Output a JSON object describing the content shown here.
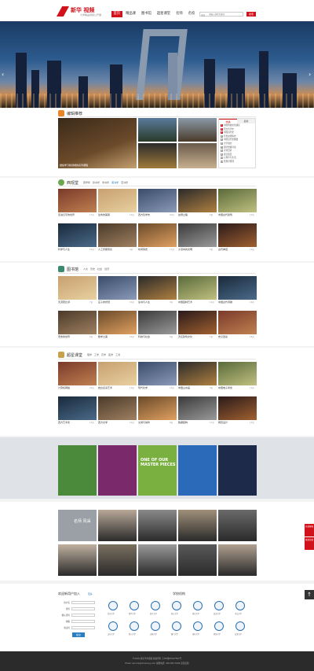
{
  "header": {
    "logo_text": "新华 视频",
    "logo_sub": "大学精品视频公开课",
    "nav": [
      "首页",
      "精品课",
      "图书馆",
      "超星课堂",
      "名师",
      "名校"
    ],
    "search_category": "全站",
    "search_placeholder": "请输入搜索关键词",
    "search_button": "搜索"
  },
  "hero": {
    "prev": "‹",
    "next": "›"
  },
  "recommend": {
    "title": "编辑推荐",
    "featured_caption": "继续学习新领域的系列课程",
    "tabs": [
      "热播",
      "最新"
    ],
    "rank": [
      "中国传统文化通论",
      "西方哲学史",
      "中国古代史",
      "世界文明简史",
      "中国近代史纲要",
      "大学语文",
      "国学经典导读",
      "宋词赏析",
      "唐诗鉴赏",
      "心理学与生活",
      "管理学原理"
    ]
  },
  "sec_culture": {
    "title": "西观堂",
    "tags": [
      "国学新",
      "欧洲史",
      "非洲史",
      "美洲史",
      "亚洲史"
    ],
    "cards": [
      {
        "title": "走进汉字的世界",
        "meta": "17讲"
      },
      {
        "title": "生命的美丽",
        "meta": "12讲"
      },
      {
        "title": "西方哲学史",
        "meta": "20讲"
      },
      {
        "title": "丝绸之路",
        "meta": "8讲"
      },
      {
        "title": "中国古代建筑",
        "meta": "15讲"
      },
      {
        "title": "科学与人生",
        "meta": "10讲"
      },
      {
        "title": "人工智能导论",
        "meta": "9讲"
      },
      {
        "title": "时间简史",
        "meta": "11讲"
      },
      {
        "title": "沙漠中的文明",
        "meta": "6讲"
      },
      {
        "title": "古代神话",
        "meta": "14讲"
      }
    ]
  },
  "sec_library": {
    "title": "图书馆",
    "tags": [
      "人文",
      "历史",
      "社会",
      "经济"
    ],
    "cards": [
      {
        "title": "天涯若比邻",
        "meta": "7讲"
      },
      {
        "title": "庄子的智慧",
        "meta": "13讲"
      },
      {
        "title": "读书与人生",
        "meta": "9讲"
      },
      {
        "title": "中国园林艺术",
        "meta": "12讲"
      },
      {
        "title": "中国古代诗歌",
        "meta": "16讲"
      },
      {
        "title": "老舍的世界",
        "meta": "6讲"
      },
      {
        "title": "数学之美",
        "meta": "10讲"
      },
      {
        "title": "科技与社会",
        "meta": "8讲"
      },
      {
        "title": "天坛建筑文化",
        "meta": "5讲"
      },
      {
        "title": "史记选读",
        "meta": "18讲"
      }
    ]
  },
  "sec_class": {
    "title": "超星课堂",
    "tags": [
      "理学",
      "工学",
      "农学",
      "医学",
      "工商"
    ],
    "cards": [
      {
        "title": "计算机网络",
        "meta": "20讲"
      },
      {
        "title": "舞台表演艺术",
        "meta": "11讲"
      },
      {
        "title": "现代化学",
        "meta": "14讲"
      },
      {
        "title": "中国山水画",
        "meta": "9讲"
      },
      {
        "title": "中国电子商务",
        "meta": "12讲"
      },
      {
        "title": "西方艺术史",
        "meta": "15讲"
      },
      {
        "title": "西方文学",
        "meta": "10讲"
      },
      {
        "title": "交通与城市",
        "meta": "8讲"
      },
      {
        "title": "数据结构",
        "meta": "17讲"
      },
      {
        "title": "网页设计",
        "meta": "13讲"
      }
    ]
  },
  "posters": [
    {
      "text": ""
    },
    {
      "text": ""
    },
    {
      "text": "ONE OF OUR MASTER PIECES"
    },
    {
      "text": ""
    },
    {
      "text": ""
    }
  ],
  "masters": {
    "tile": "名师 风采",
    "names": [
      "",
      "",
      "",
      "",
      "",
      "",
      "",
      "",
      "",
      ""
    ]
  },
  "signup": {
    "title": "欢迎新用户加入",
    "link": "更多",
    "fields": [
      "用户名",
      "密码",
      "确认密码",
      "邮箱",
      "验证码"
    ],
    "button": "提交"
  },
  "partners": {
    "title": "学校机构",
    "schools": [
      "北京大学",
      "清华大学",
      "复旦大学",
      "浙江大学",
      "南京大学",
      "武汉大学",
      "中山大学",
      "山东大学",
      "四川大学",
      "吉林大学",
      "厦门大学",
      "南开大学",
      "同济大学",
      "天津大学"
    ]
  },
  "footer": {
    "line1": "©2016 超星学术视频 版权所有  京ICP备05017567号",
    "line2": "Email: service@chaoxing.com  客服电话: 400-902-5296  意见反馈"
  },
  "sidebar": [
    "在线客服",
    "意见反馈",
    "返回顶部"
  ],
  "colors": {
    "brand": "#d2121b",
    "link": "#2a7fc1"
  }
}
